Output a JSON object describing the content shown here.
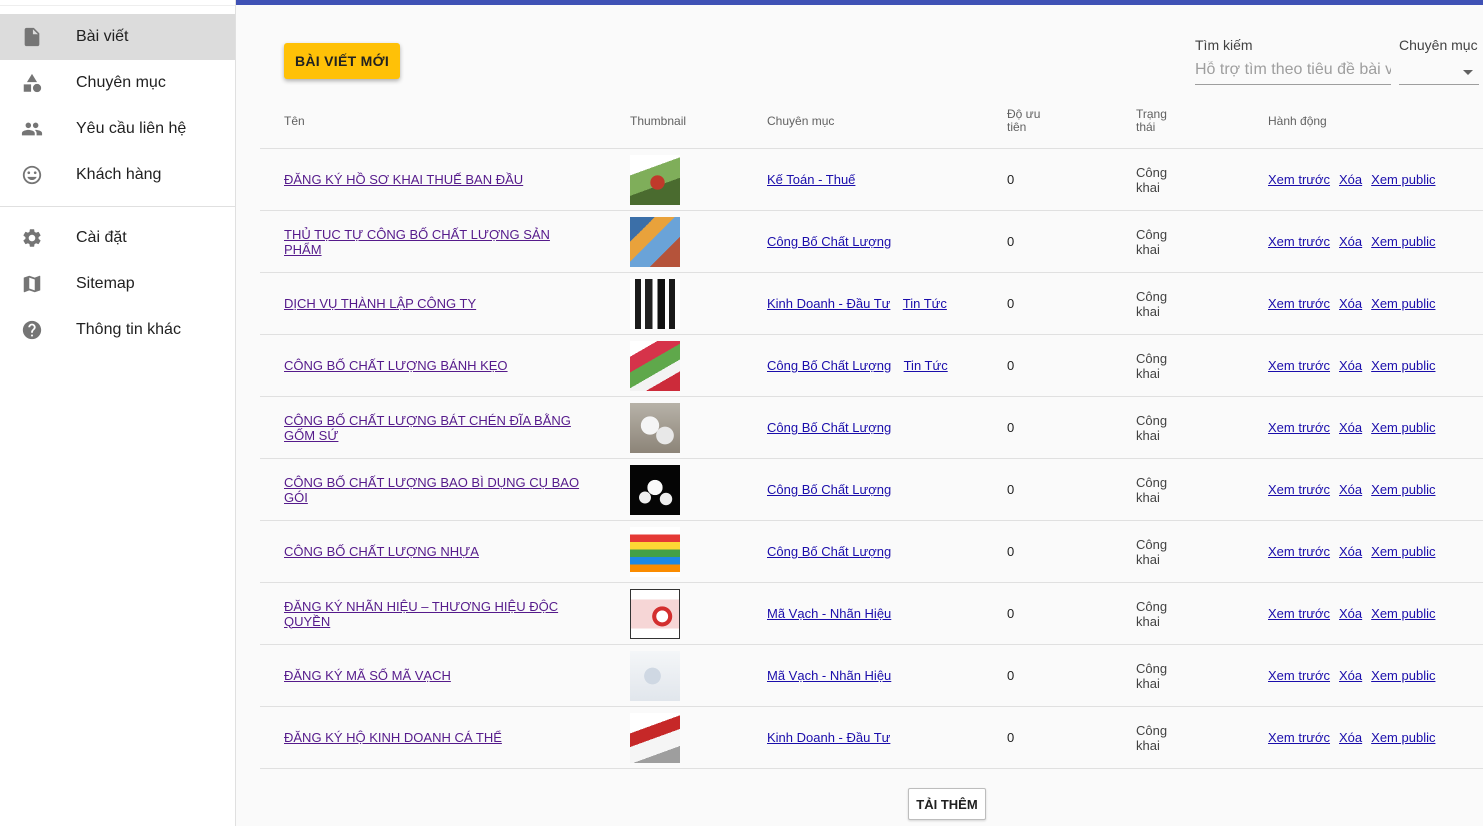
{
  "sidebar": {
    "items": [
      {
        "label": "Bài viết",
        "icon": "document-icon",
        "active": true
      },
      {
        "label": "Chuyên mục",
        "icon": "category-shapes-icon"
      },
      {
        "label": "Yêu cầu liên hệ",
        "icon": "people-icon"
      },
      {
        "label": "Khách hàng",
        "icon": "smiley-icon"
      }
    ],
    "items2": [
      {
        "label": "Cài đặt",
        "icon": "gear-icon"
      },
      {
        "label": "Sitemap",
        "icon": "map-icon"
      },
      {
        "label": "Thông tin khác",
        "icon": "help-icon"
      }
    ]
  },
  "toolbar": {
    "new_post_label": "BÀI VIẾT MỚI",
    "search_label": "Tìm kiếm",
    "search_placeholder": "Hỗ trợ tìm theo tiêu đề bài viết",
    "category_label": "Chuyên mục"
  },
  "table": {
    "headers": {
      "name": "Tên",
      "thumbnail": "Thumbnail",
      "category": "Chuyên mục",
      "priority": "Độ ưu tiên",
      "status": "Trạng thái",
      "actions": "Hành động"
    },
    "action_labels": {
      "preview": "Xem trước",
      "delete": "Xóa",
      "view_public": "Xem public"
    },
    "rows": [
      {
        "name": "ĐĂNG KÝ HỒ SƠ KHAI THUẾ BAN ĐẦU",
        "categories": [
          "Kế Toán - Thuế"
        ],
        "priority": "0",
        "status": "Công khai"
      },
      {
        "name": "THỦ TỤC TỰ CÔNG BỐ CHẤT LƯỢNG SẢN PHẨM",
        "categories": [
          "Công Bố Chất Lượng"
        ],
        "priority": "0",
        "status": "Công khai"
      },
      {
        "name": "DỊCH VỤ THÀNH LẬP CÔNG TY",
        "categories": [
          "Kinh Doanh - Đầu Tư",
          "Tin Tức"
        ],
        "priority": "0",
        "status": "Công khai"
      },
      {
        "name": "CÔNG BỐ CHẤT LƯỢNG BÁNH KẸO",
        "categories": [
          "Công Bố Chất Lượng",
          "Tin Tức"
        ],
        "priority": "0",
        "status": "Công khai"
      },
      {
        "name": "CÔNG BỐ CHẤT LƯỢNG BÁT CHÉN ĐĨA BẰNG GỐM SỨ",
        "categories": [
          "Công Bố Chất Lượng"
        ],
        "priority": "0",
        "status": "Công khai"
      },
      {
        "name": "CÔNG BỐ CHẤT LƯỢNG BAO BÌ DỤNG CỤ BAO GÓI",
        "categories": [
          "Công Bố Chất Lượng"
        ],
        "priority": "0",
        "status": "Công khai"
      },
      {
        "name": "CÔNG BỐ CHẤT LƯỢNG NHỰA",
        "categories": [
          "Công Bố Chất Lượng"
        ],
        "priority": "0",
        "status": "Công khai"
      },
      {
        "name": "ĐĂNG KÝ NHÃN HIỆU – THƯƠNG HIỆU ĐỘC QUYỀN",
        "categories": [
          "Mã Vạch - Nhãn Hiệu"
        ],
        "priority": "0",
        "status": "Công khai"
      },
      {
        "name": "ĐĂNG KÝ MÃ SỐ MÃ VẠCH",
        "categories": [
          "Mã Vạch - Nhãn Hiệu"
        ],
        "priority": "0",
        "status": "Công khai"
      },
      {
        "name": "ĐĂNG KÝ HỘ KINH DOANH CÁ THỂ",
        "categories": [
          "Kinh Doanh - Đầu Tư"
        ],
        "priority": "0",
        "status": "Công khai"
      }
    ]
  },
  "load_more_label": "TẢI THÊM",
  "colors": {
    "accent": "#3f51b5",
    "primary_button": "#ffc107",
    "link": "#1a0dab",
    "visited_link": "#551a8b"
  }
}
